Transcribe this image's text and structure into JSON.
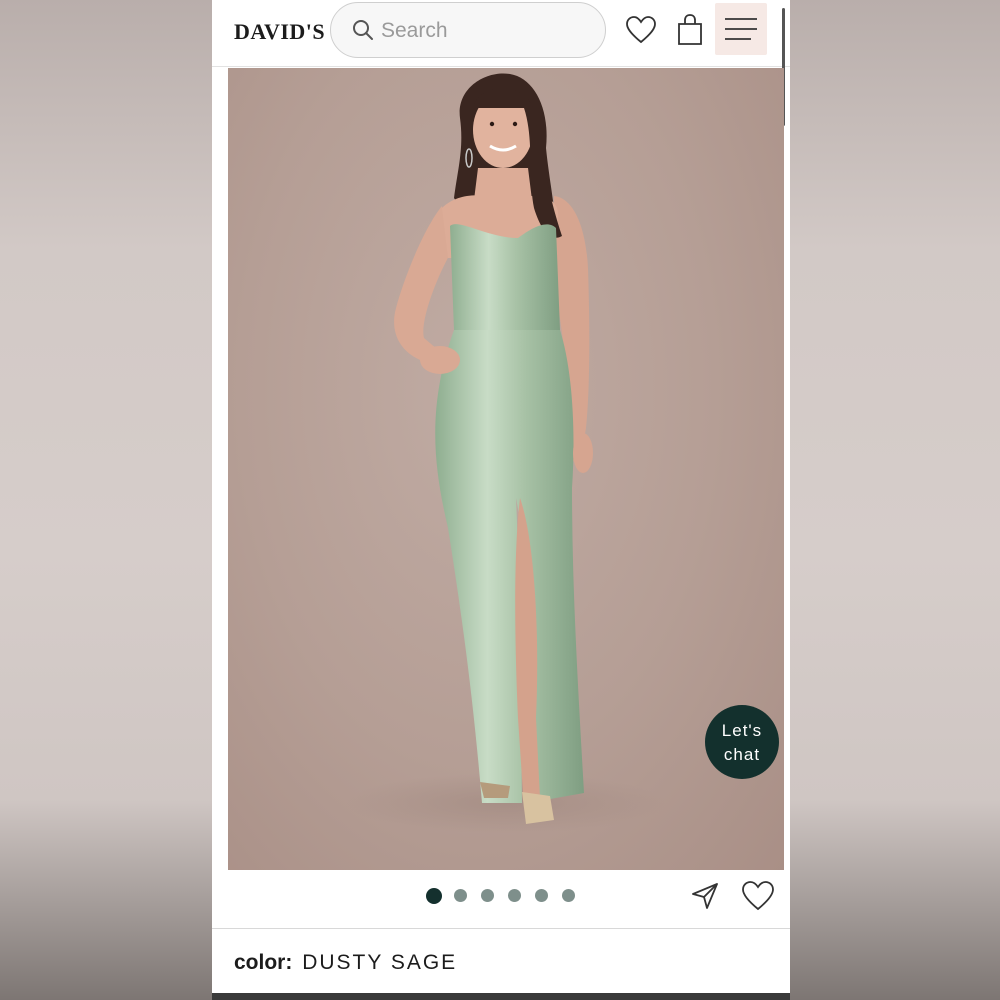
{
  "header": {
    "logo": "DAVID'S",
    "search_placeholder": "Search"
  },
  "product": {
    "image_dots": 6,
    "active_dot": 0,
    "color_label": "color:",
    "color_value": "DUSTY SAGE"
  },
  "chat": {
    "line1": "Let's",
    "line2": "chat"
  },
  "colors": {
    "accent_dark": "#14302e",
    "dot_inactive": "#7e8f8b",
    "menu_bg": "#f6e9e5",
    "photo_bg": "#b59e95",
    "dress": "#a8c2a6"
  }
}
